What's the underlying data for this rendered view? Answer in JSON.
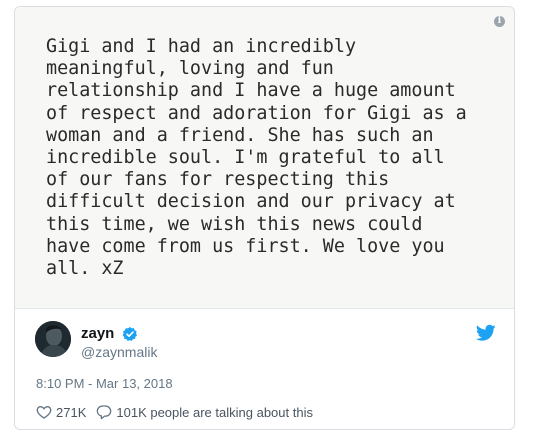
{
  "tweet": {
    "note_lines": [
      "Gigi and I had an incredibly",
      "meaningful, loving and fun",
      "relationship and I have a huge amount",
      "of respect and adoration for Gigi as a",
      "woman and a friend. She has such an",
      "incredible soul. I'm grateful to all",
      "of our fans for respecting this",
      "difficult decision and our privacy at",
      "this time, we wish this news could",
      "have come from us first. We love you",
      "all. xZ"
    ],
    "author": {
      "name": "zayn",
      "handle": "@zaynmalik",
      "verified": true
    },
    "timestamp": "8:10 PM - Mar 13, 2018",
    "likes": "271K",
    "talking": "101K people are talking about this"
  },
  "colors": {
    "twitter_blue": "#1da1f2",
    "secondary_text": "#657786",
    "heart_outline": "#657786"
  },
  "icons": [
    "info-icon",
    "verified-badge-icon",
    "twitter-bird-icon",
    "heart-icon",
    "comment-bubble-icon"
  ]
}
